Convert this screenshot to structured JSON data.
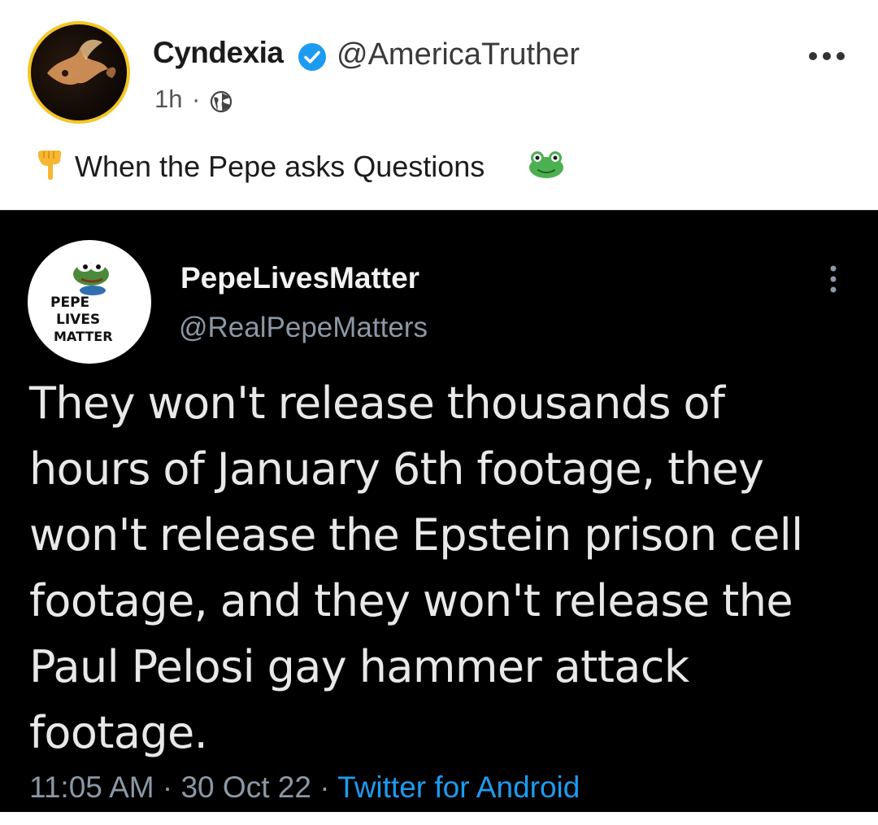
{
  "outer_post": {
    "display_name": "Cyndexia",
    "handle": "@AmericaTruther",
    "time_ago": "1h",
    "separator": "·",
    "caption": "When the Pepe asks Questions",
    "icons": {
      "verified": "verified-check-icon",
      "globe": "globe-icon",
      "more": "more-horizontal-icon",
      "point_down": "pointing-down-hand-icon",
      "frog": "frog-face-icon"
    },
    "colors": {
      "avatar_ring": "#f3c623",
      "verified": "#1d9bf0"
    }
  },
  "embedded_tweet": {
    "display_name": "PepeLivesMatter",
    "handle": "@RealPepeMatters",
    "avatar_text": {
      "line1": "PEPE",
      "line2": "LIVES",
      "line3": "MATTER"
    },
    "text": "They won't release thousands of hours of January 6th footage, they won't release the Epstein prison cell footage, and they won't release the Paul Pelosi gay hammer attack footage.",
    "time": "11:05 AM",
    "date": "30 Oct 22",
    "source": "Twitter for Android",
    "separator": "·",
    "icons": {
      "more": "more-vertical-icon"
    },
    "colors": {
      "background": "#000000",
      "link": "#1d9bf0",
      "secondary_text": "#8b98a5"
    }
  }
}
